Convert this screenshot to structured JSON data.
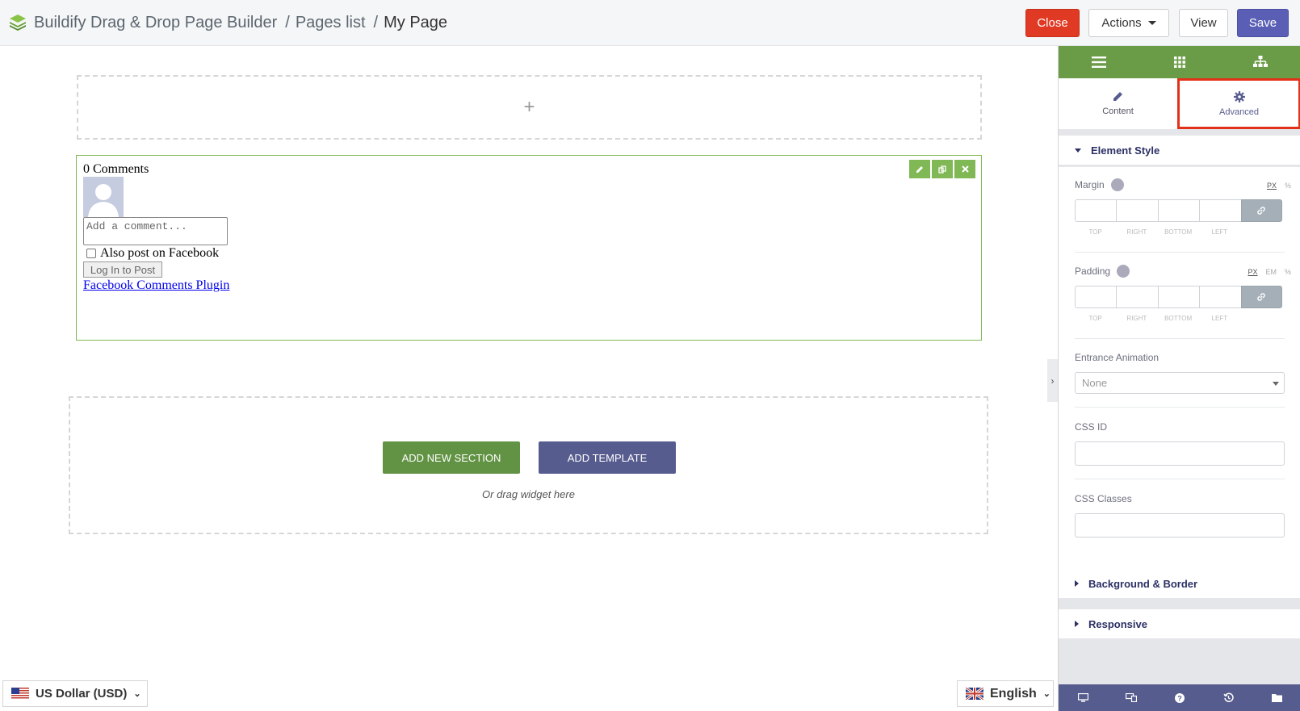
{
  "header": {
    "app_title": "Buildify Drag & Drop Page Builder",
    "sep": "/",
    "pages_list": "Pages list",
    "page_name": "My Page",
    "buttons": {
      "close": "Close",
      "actions": "Actions",
      "view": "View",
      "save": "Save"
    }
  },
  "canvas": {
    "add_plus": "+",
    "comments_widget": {
      "count_label": "0 Comments",
      "comment_placeholder": "Add a comment...",
      "also_post_label": "Also post on Facebook",
      "login_button": "Log In to Post",
      "plugin_link": "Facebook Comments Plugin"
    },
    "add_new_section": "ADD NEW SECTION",
    "add_template": "ADD TEMPLATE",
    "drag_hint": "Or drag widget here"
  },
  "footer": {
    "currency": "US Dollar (USD)",
    "language": "English"
  },
  "panel": {
    "tabs": [
      {
        "label": "Content"
      },
      {
        "label": "Advanced"
      }
    ],
    "element_style": "Element Style",
    "margin_label": "Margin",
    "padding_label": "Padding",
    "margin_units": [
      "PX",
      "%"
    ],
    "padding_units": [
      "PX",
      "EM",
      "%"
    ],
    "dim_labels": [
      "TOP",
      "RIGHT",
      "BOTTOM",
      "LEFT"
    ],
    "entrance_animation_label": "Entrance Animation",
    "entrance_animation_value": "None",
    "css_id_label": "CSS ID",
    "css_classes_label": "CSS Classes",
    "background_border": "Background & Border",
    "responsive": "Responsive"
  },
  "colors": {
    "panel_green": "#6a9b46",
    "panel_purple": "#575c8f",
    "close_red": "#e03a24",
    "save_blue": "#5a5fb5",
    "widget_border": "#80b855",
    "highlight_red": "#e33119"
  }
}
